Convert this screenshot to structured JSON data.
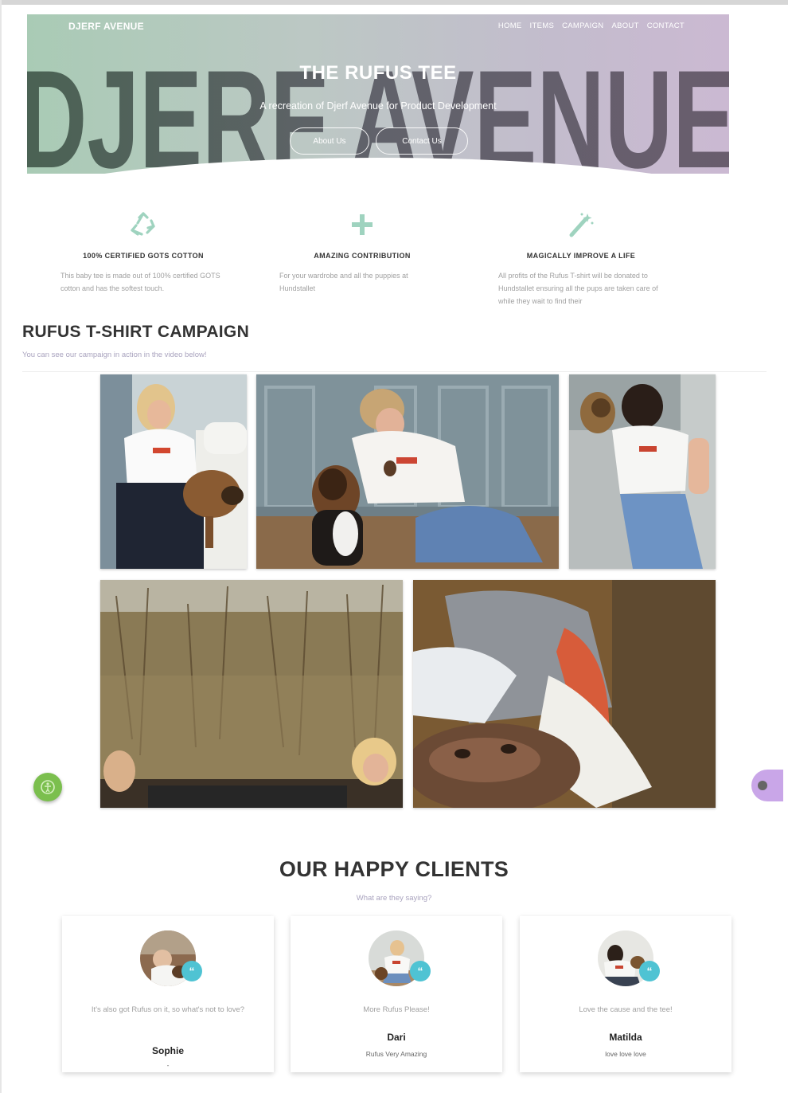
{
  "header": {
    "brand": "DJERF AVENUE",
    "nav": [
      "HOME",
      "ITEMS",
      "CAMPAIGN",
      "ABOUT",
      "CONTACT"
    ],
    "big_word": "DJERF AVENUE",
    "title": "THE RUFUS TEE",
    "subtitle": "A recreation of Djerf Avenue for Product Development",
    "buttons": [
      "About Us",
      "Contact Us"
    ]
  },
  "features": [
    {
      "icon": "recycle-icon",
      "title": "100% CERTIFIED GOTS COTTON",
      "desc": "This baby tee is made out of 100% certified GOTS cotton and has the softest touch."
    },
    {
      "icon": "plus-icon",
      "title": "AMAZING CONTRIBUTION",
      "desc": "For your wardrobe and all the puppies at Hundstallet"
    },
    {
      "icon": "magic-wand-icon",
      "title": "MAGICALLY IMPROVE A LIFE",
      "desc": "All profits of the Rufus T-shirt will be donated to Hundstallet ensuring all the pups are taken care of while they wait to find their"
    }
  ],
  "campaign": {
    "title": "RUFUS T-SHIRT CAMPAIGN",
    "subtitle": "You can see our campaign in action in the video below!"
  },
  "clients": {
    "title": "OUR HAPPY CLIENTS",
    "subtitle": "What are they saying?",
    "cards": [
      {
        "text": "It's also got Rufus on it, so what's not to love?",
        "name": "Sophie",
        "role": "-"
      },
      {
        "text": "More Rufus Please!",
        "name": "Dari",
        "role": "Rufus Very Amazing"
      },
      {
        "text": "Love the cause and the tee!",
        "name": "Matilda",
        "role": "love love love"
      }
    ]
  },
  "colors": {
    "hero_left": "#a9cbb5",
    "hero_right": "#cbb9d2",
    "quote_badge": "#4fc3d3",
    "feature_icon": "#9fd3bf",
    "float_left": "#7bbf4e",
    "float_right": "#c9a6e8"
  }
}
